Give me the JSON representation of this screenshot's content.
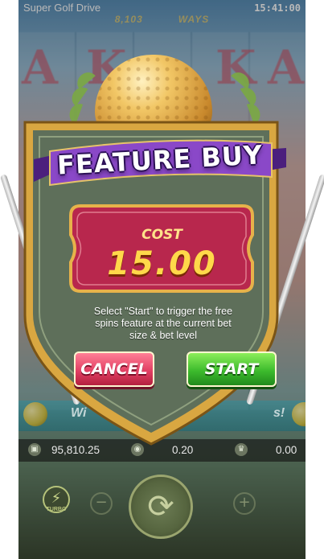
{
  "header": {
    "title": "Super Golf Drive",
    "clock": "15:41:00",
    "ways_left": "8,103",
    "ways_right": "WAYS"
  },
  "dialog": {
    "banner_title": "FEATURE BUY",
    "cost_label": "COST",
    "cost_value": "15.00",
    "description": "Select \"Start\" to trigger the free spins feature at the current bet size & bet level",
    "cancel_label": "CANCEL",
    "start_label": "START"
  },
  "background": {
    "reel_symbols": [
      "A",
      "K",
      "K",
      "A"
    ],
    "promo_text_left": "Wi",
    "promo_text_right": "s!"
  },
  "stats": {
    "balance": "95,810.25",
    "bet": "0.20",
    "win": "0.00"
  },
  "controls": {
    "turbo_label": "TURBO"
  },
  "colors": {
    "banner": "#7a3fb4",
    "cost_panel": "#b8274d",
    "cost_value": "#ffd84a",
    "cancel_button": "#e24064",
    "start_button": "#3dbb2d",
    "shield": "#5e6f5a",
    "gold_frame": "#d9a741"
  },
  "icons": [
    "wallet-icon",
    "coin-icon",
    "trophy-icon",
    "turbo-lightning-icon",
    "spin-arrows-icon",
    "minus-icon",
    "plus-icon"
  ]
}
